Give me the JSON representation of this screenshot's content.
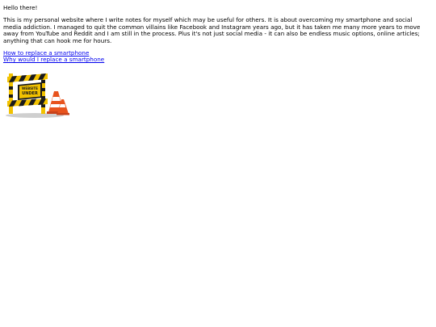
{
  "page": {
    "greeting": "Hello there!",
    "intro": "This is my personal website where I write notes for myself which may be useful for others. It is about overcoming my smartphone and social media addiction. I managed to quit the common villains like Facebook and Instagram years ago, but it has taken me many more years to move away from YouTube and Reddit and I am still in the process. Plus it's not just social media - it can also be endless music options, online articles; anything that can hook me for hours.",
    "links": [
      {
        "label": "How to replace a smartphone"
      },
      {
        "label": "Why would I replace a smartphone"
      }
    ],
    "image": {
      "icon": "under-construction-barrier",
      "sign_text_top": "WEBSITE",
      "sign_text_bottom": "UNDER",
      "colors": {
        "yellow": "#f2c200",
        "black": "#1a1a1a",
        "cone": "#e8531d",
        "link": "#0000ee"
      }
    }
  }
}
